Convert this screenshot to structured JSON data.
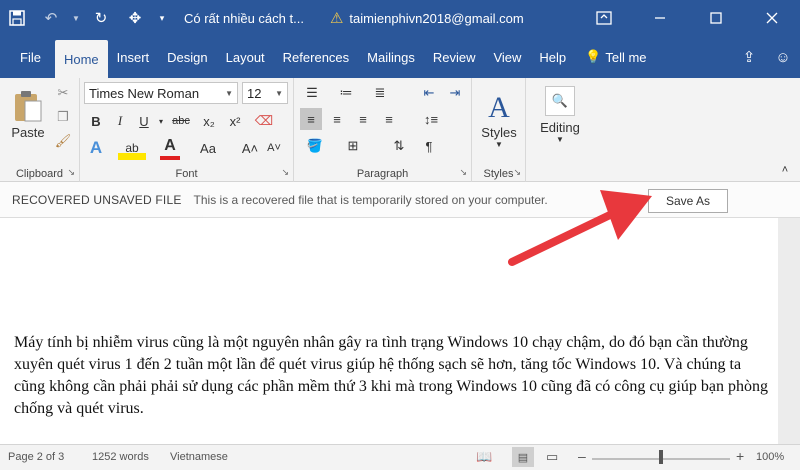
{
  "titlebar": {
    "doc_title": "Có rất nhiều cách t...",
    "account": "taimienphivn2018@gmail.com"
  },
  "tabs": [
    "File",
    "Home",
    "Insert",
    "Design",
    "Layout",
    "References",
    "Mailings",
    "Review",
    "View",
    "Help"
  ],
  "tell_me": "Tell me",
  "ribbon": {
    "paste": "Paste",
    "font_name": "Times New Roman",
    "font_size": "12",
    "styles": "Styles",
    "editing": "Editing",
    "groups": {
      "clipboard": "Clipboard",
      "font": "Font",
      "paragraph": "Paragraph",
      "styles": "Styles"
    },
    "font_buttons": {
      "bold": "B",
      "italic": "I",
      "underline": "U",
      "strike": "abc",
      "subscript": "x₂",
      "superscript": "x²",
      "text_effects": "A",
      "highlight": "ab",
      "font_color": "A",
      "change_case": "Aa",
      "grow": "A˄",
      "shrink": "A˅"
    }
  },
  "recovered": {
    "title": "RECOVERED UNSAVED FILE",
    "message": "This is a recovered file that is temporarily stored on your computer.",
    "save_as": "Save As"
  },
  "document": {
    "text": "Máy tính bị nhiễm virus cũng là một nguyên nhân gây ra tình trạng Windows 10 chạy chậm, do đó bạn cần thường xuyên quét virus 1 đến 2 tuần một lần để quét virus giúp hệ thống sạch sẽ hơn, tăng tốc Windows 10. Và chúng ta cũng không cần phải phải sử dụng các phần mềm thứ 3 khi mà trong Windows 10 cũng đã có công cụ giúp bạn phòng chống và quét virus."
  },
  "status": {
    "page": "Page 2 of 3",
    "words": "1252 words",
    "language": "Vietnamese",
    "zoom_out": "–",
    "zoom_in": "+",
    "zoom": "100%"
  },
  "colors": {
    "titlebar": "#2b579a",
    "arrow": "#e8383d",
    "warning": "#f2c94c"
  },
  "icons": [
    "save-icon",
    "undo-icon",
    "redo-icon",
    "touch-mode-icon",
    "customize-icon",
    "warning-icon",
    "ribbon-display-icon",
    "minimize-icon",
    "maximize-icon",
    "close-icon",
    "lightbulb-icon",
    "share-icon",
    "comments-icon"
  ]
}
